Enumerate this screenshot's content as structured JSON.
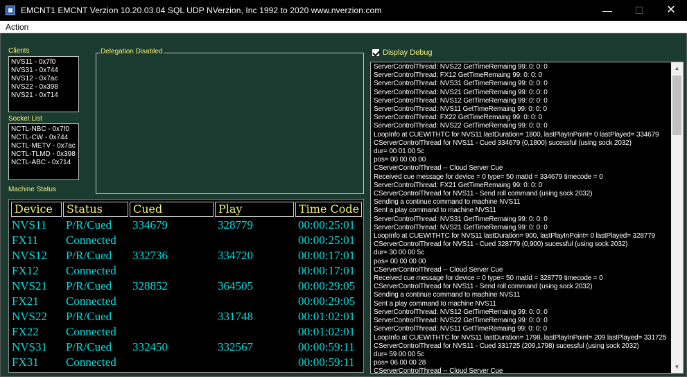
{
  "window": {
    "title": "EMCNT1 EMCNT Verzion 10.20.03.04 SQL UDP    NVerzion, Inc 1992 to 2020    www.nverzion.com",
    "minimize_glyph": "—",
    "maximize_glyph": "☐",
    "close_glyph": "✕"
  },
  "menu": {
    "action": "Action"
  },
  "clients": {
    "label": "Clients",
    "items": [
      "NVS11 - 0x7f0",
      "NVS31 - 0x744",
      "NVS12 - 0x7ac",
      "NVS22 - 0x398",
      "NVS21 - 0x714"
    ]
  },
  "socket_list": {
    "label": "Socket List",
    "items": [
      "NCTL-NBC - 0x7f0",
      "NCTL-CW - 0x744",
      "NCTL-METV - 0x7ac",
      "NCTL-TLMD - 0x398",
      "NCTL-ABC - 0x714"
    ]
  },
  "delegation": {
    "label": "Delegation Disabled"
  },
  "machine_status": {
    "label": "Machine Status",
    "headers": [
      "Device",
      "Status",
      "Cued",
      "Play",
      "Time Code"
    ],
    "rows": [
      {
        "device": "NVS11",
        "status": "P/R/Cued",
        "cued": "334679",
        "play": "328779",
        "tc": "00:00:25:01"
      },
      {
        "device": "FX11",
        "status": "Connected",
        "cued": "",
        "play": "",
        "tc": "00:00:25:01"
      },
      {
        "device": "NVS12",
        "status": "P/R/Cued",
        "cued": "332736",
        "play": "334720",
        "tc": "00:00:17:01"
      },
      {
        "device": "FX12",
        "status": "Connected",
        "cued": "",
        "play": "",
        "tc": "00:00:17:01"
      },
      {
        "device": "NVS21",
        "status": "P/R/Cued",
        "cued": "328852",
        "play": "364505",
        "tc": "00:00:29:05"
      },
      {
        "device": "FX21",
        "status": "Connected",
        "cued": "",
        "play": "",
        "tc": "00:00:29:05"
      },
      {
        "device": "NVS22",
        "status": "P/R/Cued",
        "cued": "",
        "play": "331748",
        "tc": "00:01:02:01"
      },
      {
        "device": "FX22",
        "status": "Connected",
        "cued": "",
        "play": "",
        "tc": "00:01:02:01"
      },
      {
        "device": "NVS31",
        "status": "P/R/Cued",
        "cued": "332450",
        "play": "332567",
        "tc": "00:00:59:11"
      },
      {
        "device": "FX31",
        "status": "Connected",
        "cued": "",
        "play": "",
        "tc": "00:00:59:11"
      }
    ]
  },
  "debug": {
    "checkbox_label": "Display Debug",
    "checked": true,
    "scroll_up_glyph": "▲",
    "scroll_down_glyph": "▼",
    "lines": [
      "ServerControlThread: NVS22 GetTimeRemaing 99: 0: 0: 0",
      "ServerControlThread: FX12 GetTimeRemaing 99: 0: 0: 0",
      "ServerControlThread: NVS31 GetTimeRemaing 99: 0: 0: 0",
      "ServerControlThread: NVS21 GetTimeRemaing 99: 0: 0: 0",
      "ServerControlThread: NVS12 GetTimeRemaing 99: 0: 0: 0",
      "ServerControlThread: NVS11 GetTimeRemaing 99: 0: 0: 0",
      "ServerControlThread: FX22 GetTimeRemaing 99: 0: 0: 0",
      "ServerControlThread: NVS22 GetTimeRemaing 99: 0: 0: 0",
      "LoopInfo at CUEWITHTC for NVS11  lastDuration= 1800, lastPlayInPoint= 0 lastPlayed= 334679",
      "CServerControlThread for NVS11 - Cued 334679 (0,1800) sucessful (using sock 2032)",
      "dur= 00 01 00 5c",
      "pos= 00 00 00 00",
      "CServerControlThread -- Cloud Server Cue",
      "Received cue message  for device = 0 type= 50 matId = 334679 timecode = 0",
      "ServerControlThread: FX21 GetTimeRemaing 99: 0: 0: 0",
      "CServerControlThread for NVS11 - Send roll command (using sock 2032)",
      "Sending a continue command to machine NVS11",
      "Sent a play command to machine NVS11",
      "ServerControlThread: NVS31 GetTimeRemaing 99: 0: 0: 0",
      "ServerControlThread: NVS21 GetTimeRemaing 99: 0: 0: 0",
      "LoopInfo at CUEWITHTC for NVS11  lastDuration= 900, lastPlayInPoint= 0 lastPlayed= 328779",
      "CServerControlThread for NVS11 - Cued 328779 (0,900) sucessful (using sock 2032)",
      "dur= 30 00 00 5c",
      "pos= 00 00 00 00",
      "CServerControlThread -- Cloud Server Cue",
      "Received cue message  for device = 0 type= 50 matId = 328779 timecode = 0",
      "CServerControlThread for NVS11 - Send roll command (using sock 2032)",
      "Sending a continue command to machine NVS11",
      "Sent a play command to machine NVS11",
      "ServerControlThread: NVS12 GetTimeRemaing 99: 0: 0: 0",
      "ServerControlThread: NVS22 GetTimeRemaing 99: 0: 0: 0",
      "ServerControlThread: NVS11 GetTimeRemaing 99: 0: 0: 0",
      "LoopInfo at CUEWITHTC for NVS11  lastDuration= 1798, lastPlayInPoint= 209 lastPlayed= 331725",
      "CServerControlThread for NVS11 - Cued 331725 (209,1798) sucessful (using sock 2032)",
      "dur= 59 00 00 5c",
      "pos= 06 00 00 28",
      "CServerControlThread -- Cloud Server Cue"
    ]
  }
}
